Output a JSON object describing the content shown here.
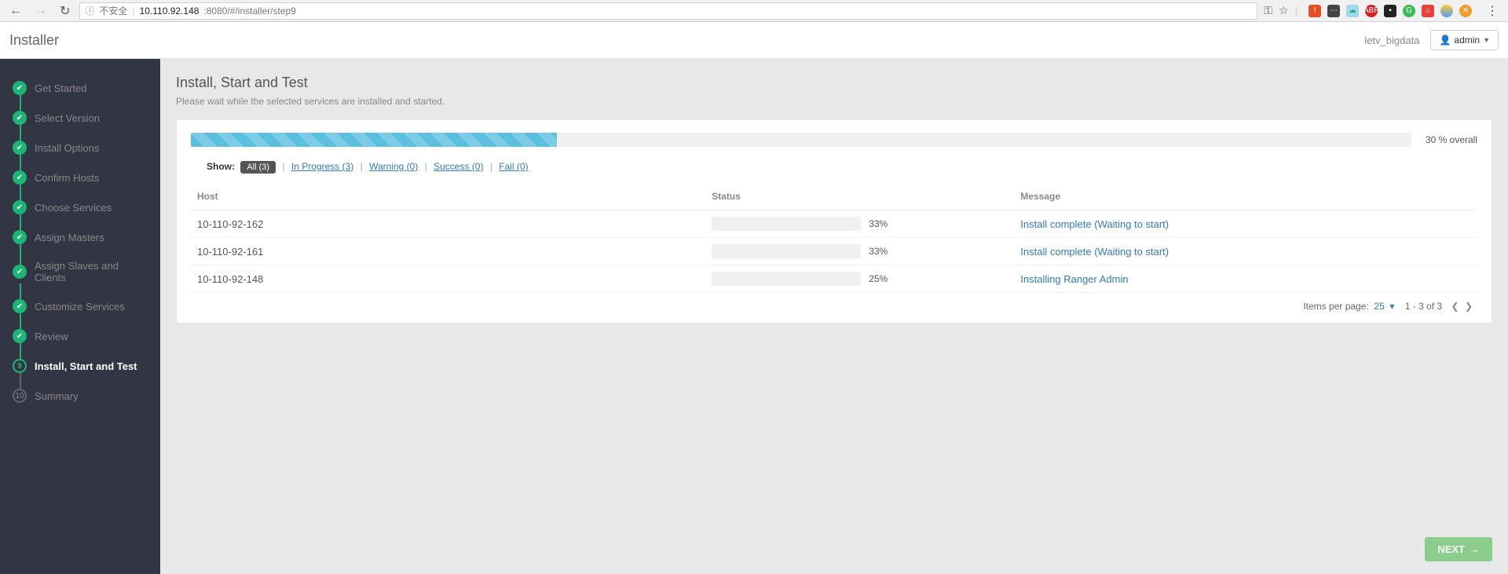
{
  "browser": {
    "insecure_label": "不安全",
    "url_host": "10.110.92.148",
    "url_port_path": ":8080/#/installer/step9"
  },
  "header": {
    "app_title": "Installer",
    "cluster_name": "letv_bigdata",
    "admin_label": "admin"
  },
  "sidebar": {
    "steps": [
      {
        "label": "Get Started"
      },
      {
        "label": "Select Version"
      },
      {
        "label": "Install Options"
      },
      {
        "label": "Confirm Hosts"
      },
      {
        "label": "Choose Services"
      },
      {
        "label": "Assign Masters"
      },
      {
        "label": "Assign Slaves and Clients"
      },
      {
        "label": "Customize Services"
      },
      {
        "label": "Review"
      },
      {
        "label": "Install, Start and Test"
      },
      {
        "label": "Summary"
      }
    ],
    "active_num": "9",
    "pending_num": "10"
  },
  "main": {
    "heading": "Install, Start and Test",
    "subheading": "Please wait while the selected services are installed and started.",
    "overall_pct_text": "30 % overall",
    "overall_pct_value": 30,
    "filters": {
      "show_label": "Show:",
      "all": "All (3)",
      "in_progress": "In Progress (3)",
      "warning": "Warning (0)",
      "success": "Success (0)",
      "fail": "Fail (0)"
    },
    "columns": {
      "host": "Host",
      "status": "Status",
      "message": "Message"
    },
    "rows": [
      {
        "host": "10-110-92-162",
        "pct": 33,
        "pct_text": "33%",
        "message": "Install complete (Waiting to start)"
      },
      {
        "host": "10-110-92-161",
        "pct": 33,
        "pct_text": "33%",
        "message": "Install complete (Waiting to start)"
      },
      {
        "host": "10-110-92-148",
        "pct": 25,
        "pct_text": "25%",
        "message": "Installing Ranger Admin"
      }
    ],
    "pager": {
      "items_label": "Items per page:",
      "per_page": "25",
      "range": "1 - 3 of 3"
    },
    "next_label": "NEXT"
  }
}
